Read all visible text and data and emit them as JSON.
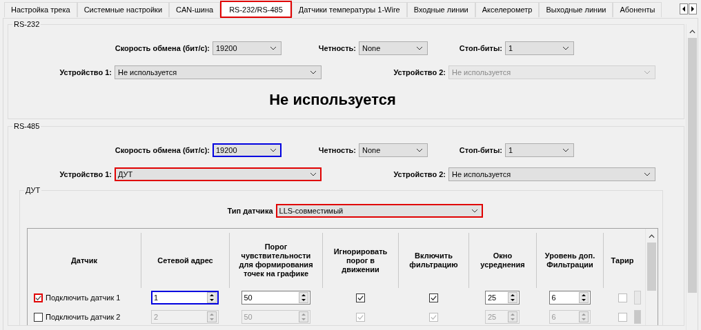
{
  "tabs": [
    {
      "label": "Настройка трека",
      "selected": false
    },
    {
      "label": "Системные настройки",
      "selected": false
    },
    {
      "label": "CAN-шина",
      "selected": false
    },
    {
      "label": "RS-232/RS-485",
      "selected": true,
      "color": "#e00000"
    },
    {
      "label": "Датчики температуры 1-Wire",
      "selected": false
    },
    {
      "label": "Входные линии",
      "selected": false
    },
    {
      "label": "Акселерометр",
      "selected": false
    },
    {
      "label": "Выходные линии",
      "selected": false
    },
    {
      "label": "Абоненты",
      "selected": false
    }
  ],
  "rs232": {
    "title": "RS-232",
    "speed": {
      "label": "Скорость обмена (бит/с):",
      "value": "19200",
      "disabled": false
    },
    "parity": {
      "label": "Четность:",
      "value": "None",
      "disabled": false
    },
    "stop_bits": {
      "label": "Стоп-биты:",
      "value": "1",
      "disabled": false
    },
    "device_1": {
      "label": "Устройство 1:",
      "value": "Не используется",
      "disabled": false
    },
    "device_2": {
      "label": "Устройство 2:",
      "value": "Не используется",
      "disabled": true
    },
    "message": "Не используется"
  },
  "rs485": {
    "title": "RS-485",
    "speed": {
      "label": "Скорость обмена (бит/с):",
      "value": "19200",
      "disabled": false,
      "color": "#0000e0"
    },
    "parity": {
      "label": "Четность:",
      "value": "None",
      "disabled": false
    },
    "stop_bits": {
      "label": "Стоп-биты:",
      "value": "1",
      "disabled": false
    },
    "device_1": {
      "label": "Устройство 1:",
      "value": "ДУТ",
      "disabled": false,
      "color": "#e00000"
    },
    "device_2": {
      "label": "Устройство 2:",
      "value": "Не используется",
      "disabled": false
    },
    "device": {
      "title": "ДУТ",
      "sensor_type": {
        "label": "Тип датчика",
        "value": "LLS-совместимый",
        "color": "#e00000"
      },
      "table": {
        "columns": [
          "Датчик",
          "Сетевой адрес",
          "Порог чувствительности для формирования точек на графике",
          "Игнорировать порог в движении",
          "Включить фильтрацию",
          "Окно усреднения",
          "Уровень доп. Фильтрации",
          "Тарир"
        ],
        "rows": [
          {
            "connect": {
              "label": "Подключить датчик 1",
              "checked": true,
              "color": "#e00000"
            },
            "disabled": false,
            "address": {
              "value": "1",
              "color": "#0000e0"
            },
            "threshold": "50",
            "ignore_threshold": true,
            "filtering": true,
            "window": "25",
            "filter_level": "6",
            "tariff": false
          },
          {
            "connect": {
              "label": "Подключить датчик 2",
              "checked": false
            },
            "disabled": true,
            "address": {
              "value": "2"
            },
            "threshold": "50",
            "ignore_threshold": true,
            "filtering": true,
            "window": "25",
            "filter_level": "6",
            "tariff": false
          }
        ]
      }
    }
  }
}
